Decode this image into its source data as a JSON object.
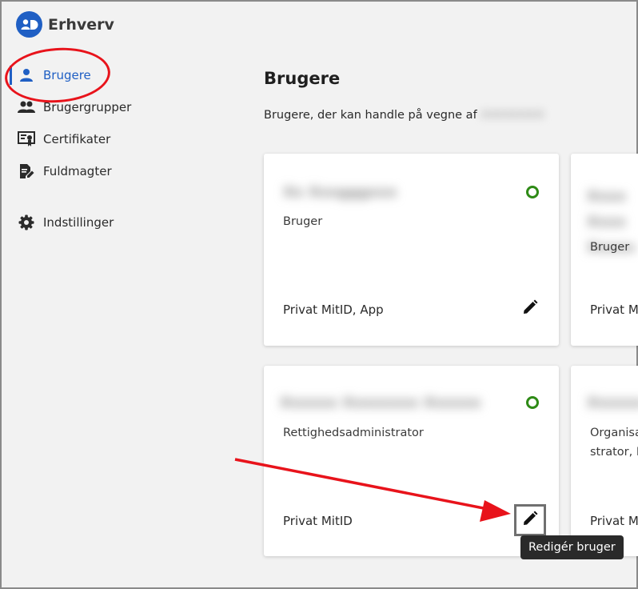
{
  "app": {
    "title": "Erhverv"
  },
  "sidebar": {
    "items": [
      {
        "label": "Brugere",
        "icon": "person-icon",
        "active": true
      },
      {
        "label": "Brugergrupper",
        "icon": "group-icon",
        "active": false
      },
      {
        "label": "Certifikater",
        "icon": "certificate-icon",
        "active": false
      },
      {
        "label": "Fuldmagter",
        "icon": "document-edit-icon",
        "active": false
      }
    ],
    "settings": {
      "label": "Indstillinger",
      "icon": "gear-icon"
    }
  },
  "main": {
    "title": "Brugere",
    "subtitle": "Brugere, der kan handle på vegne af",
    "company_redacted": "XXXXXXXX"
  },
  "cards": [
    {
      "name": "Xx Xxxgggxxx",
      "role": "Bruger",
      "method": "Privat MitID, App",
      "status": "active"
    },
    {
      "name": "Xxxx Xxxx Xxxxx",
      "role": "Bruger",
      "method": "Privat M",
      "status": "active"
    },
    {
      "name": "Xxxxxx Xxxxxxxx Xxxxxx",
      "role": "Rettighedsadministrator",
      "method": "Privat MitID",
      "status": "active"
    },
    {
      "name": "Xxxxxx",
      "role": "Organisa strator, F",
      "method": "Privat M",
      "status": "active"
    }
  ],
  "tooltip": {
    "text": "Redigér bruger"
  },
  "colors": {
    "brand": "#1f5fc4",
    "status_active": "#2e8a16",
    "annotation": "#e8131b"
  }
}
